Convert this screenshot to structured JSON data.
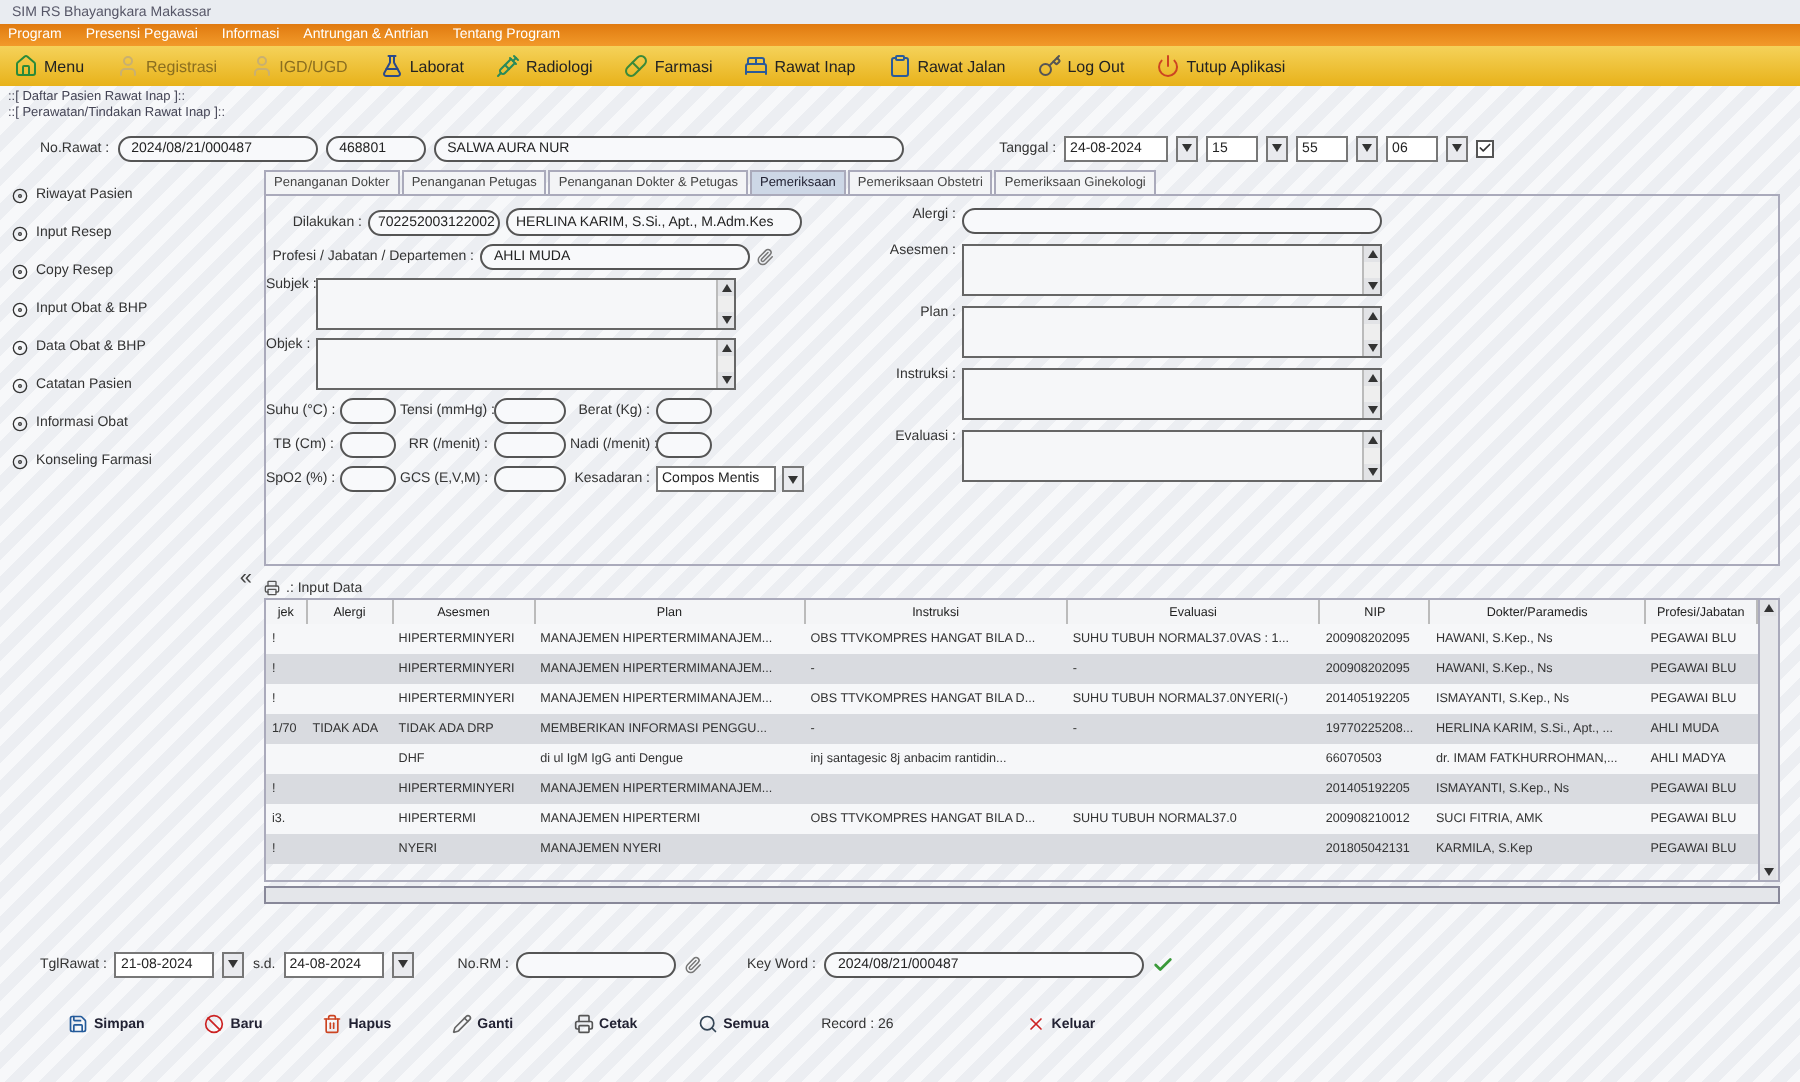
{
  "window": {
    "title": "SIM RS Bhayangkara Makassar"
  },
  "menu": [
    "Program",
    "Presensi Pegawai",
    "Informasi",
    "Antrungan & Antrian",
    "Tentang Program"
  ],
  "toolbar": [
    {
      "label": "Menu",
      "disabled": false
    },
    {
      "label": "Registrasi",
      "disabled": true
    },
    {
      "label": "IGD/UGD",
      "disabled": true
    },
    {
      "label": "Laborat",
      "disabled": false
    },
    {
      "label": "Radiologi",
      "disabled": false
    },
    {
      "label": "Farmasi",
      "disabled": false
    },
    {
      "label": "Rawat Inap",
      "disabled": false
    },
    {
      "label": "Rawat Jalan",
      "disabled": false
    },
    {
      "label": "Log Out",
      "disabled": false
    },
    {
      "label": "Tutup Aplikasi",
      "disabled": false
    }
  ],
  "breadcrumbs": [
    "::[ Daftar Pasien Rawat Inap ]::",
    "::[ Perawatan/Tindakan Rawat Inap ]::"
  ],
  "header": {
    "no_rawat_label": "No.Rawat :",
    "no_rawat": "2024/08/21/000487",
    "rm": "468801",
    "name": "SALWA AURA NUR",
    "tanggal_label": "Tanggal :",
    "date": "24-08-2024",
    "hour": "15",
    "minute": "55",
    "second": "06",
    "checked": true
  },
  "sidebar": {
    "items": [
      "Riwayat Pasien",
      "Input Resep",
      "Copy Resep",
      "Input Obat & BHP",
      "Data Obat & BHP",
      "Catatan Pasien",
      "Informasi Obat",
      "Konseling Farmasi"
    ],
    "collapse": "«"
  },
  "tabs": [
    {
      "label": "Penanganan Dokter",
      "selected": false
    },
    {
      "label": "Penanganan Petugas",
      "selected": false
    },
    {
      "label": "Penanganan Dokter & Petugas",
      "selected": false
    },
    {
      "label": "Pemeriksaan",
      "selected": true
    },
    {
      "label": "Pemeriksaan Obstetri",
      "selected": false
    },
    {
      "label": "Pemeriksaan Ginekologi",
      "selected": false
    }
  ],
  "form": {
    "dilakukan_label": "Dilakukan :",
    "dilakukan_nip": "702252003122002",
    "dilakukan_name": "HERLINA KARIM, S.Si., Apt., M.Adm.Kes",
    "profesi_label": "Profesi / Jabatan / Departemen :",
    "profesi": "AHLI MUDA",
    "subjek_label": "Subjek :",
    "objek_label": "Objek :",
    "vitals": [
      {
        "label": "Suhu (°C) :",
        "kind": "field"
      },
      {
        "label": "Tensi (mmHg) :",
        "kind": "field"
      },
      {
        "label": "Berat (Kg) :",
        "kind": "field"
      },
      {
        "label": "TB (Cm) :",
        "kind": "field"
      },
      {
        "label": "RR (/menit) :",
        "kind": "field"
      },
      {
        "label": "Nadi (/menit) :",
        "kind": "field"
      },
      {
        "label": "SpO2 (%) :",
        "kind": "field"
      },
      {
        "label": "GCS (E,V,M) :",
        "kind": "field"
      },
      {
        "label": "Kesadaran :",
        "kind": "select",
        "value": "Compos Mentis"
      }
    ],
    "right_fields": [
      {
        "label": "Alergi :",
        "kind": "field"
      },
      {
        "label": "Asesmen :",
        "kind": "area"
      },
      {
        "label": "Plan :",
        "kind": "area"
      },
      {
        "label": "Instruksi :",
        "kind": "area"
      },
      {
        "label": "Evaluasi :",
        "kind": "area"
      }
    ]
  },
  "table": {
    "title": ".: Input Data",
    "columns": [
      "jek",
      "Alergi",
      "Asesmen",
      "Plan",
      "Instruksi",
      "Evaluasi",
      "NIP",
      "Dokter/Paramedis",
      "Profesi/Jabatan"
    ],
    "rows": [
      [
        "!",
        "",
        "HIPERTERMINYERI",
        "MANAJEMEN HIPERTERMIMANAJEM...",
        "OBS TTVKOMPRES HANGAT BILA D...",
        "SUHU TUBUH NORMAL37.0VAS : 1...",
        "200908202095",
        "HAWANI, S.Kep., Ns",
        "PEGAWAI BLU"
      ],
      [
        "!",
        "",
        "HIPERTERMINYERI",
        "MANAJEMEN HIPERTERMIMANAJEM...",
        "-",
        "-",
        "200908202095",
        "HAWANI, S.Kep., Ns",
        "PEGAWAI BLU"
      ],
      [
        "!",
        "",
        "HIPERTERMINYERI",
        "MANAJEMEN HIPERTERMIMANAJEM...",
        "OBS TTVKOMPRES HANGAT BILA D...",
        "SUHU TUBUH NORMAL37.0NYERI(-)",
        "201405192205",
        "ISMAYANTI, S.Kep., Ns",
        "PEGAWAI BLU"
      ],
      [
        "1/70",
        "TIDAK ADA",
        "TIDAK ADA DRP",
        "MEMBERIKAN INFORMASI PENGGU...",
        "-",
        "-",
        "19770225208...",
        "HERLINA KARIM, S.Si., Apt., ...",
        "AHLI MUDA"
      ],
      [
        "",
        "",
        "DHF",
        "di ul IgM IgG anti Dengue",
        "inj santagesic 8j anbacim rantidin...",
        "",
        "66070503",
        "dr. IMAM FATKHURROHMAN,...",
        "AHLI MADYA"
      ],
      [
        "!",
        "",
        "HIPERTERMINYERI",
        "MANAJEMEN HIPERTERMIMANAJEM...",
        "",
        "",
        "201405192205",
        "ISMAYANTI, S.Kep., Ns",
        "PEGAWAI BLU"
      ],
      [
        "i3.",
        "",
        "HIPERTERMI",
        "MANAJEMEN HIPERTERMI",
        "OBS TTVKOMPRES HANGAT BILA D...",
        "SUHU TUBUH NORMAL37.0",
        "200908210012",
        "SUCI FITRIA, AMK",
        "PEGAWAI BLU"
      ],
      [
        "!",
        "",
        "NYERI",
        "MANAJEMEN NYERI",
        "",
        "",
        "201805042131",
        "KARMILA, S.Kep",
        "PEGAWAI BLU"
      ]
    ]
  },
  "filter": {
    "tgl_label": "TglRawat :",
    "from": "21-08-2024",
    "sd_label": "s.d.",
    "to": "24-08-2024",
    "rm_label": "No.RM :",
    "keyword_label": "Key Word :",
    "keyword": "2024/08/21/000487"
  },
  "actions": [
    "Simpan",
    "Baru",
    "Hapus",
    "Ganti",
    "Cetak",
    "Semua",
    "Keluar"
  ],
  "record": "Record : 26"
}
